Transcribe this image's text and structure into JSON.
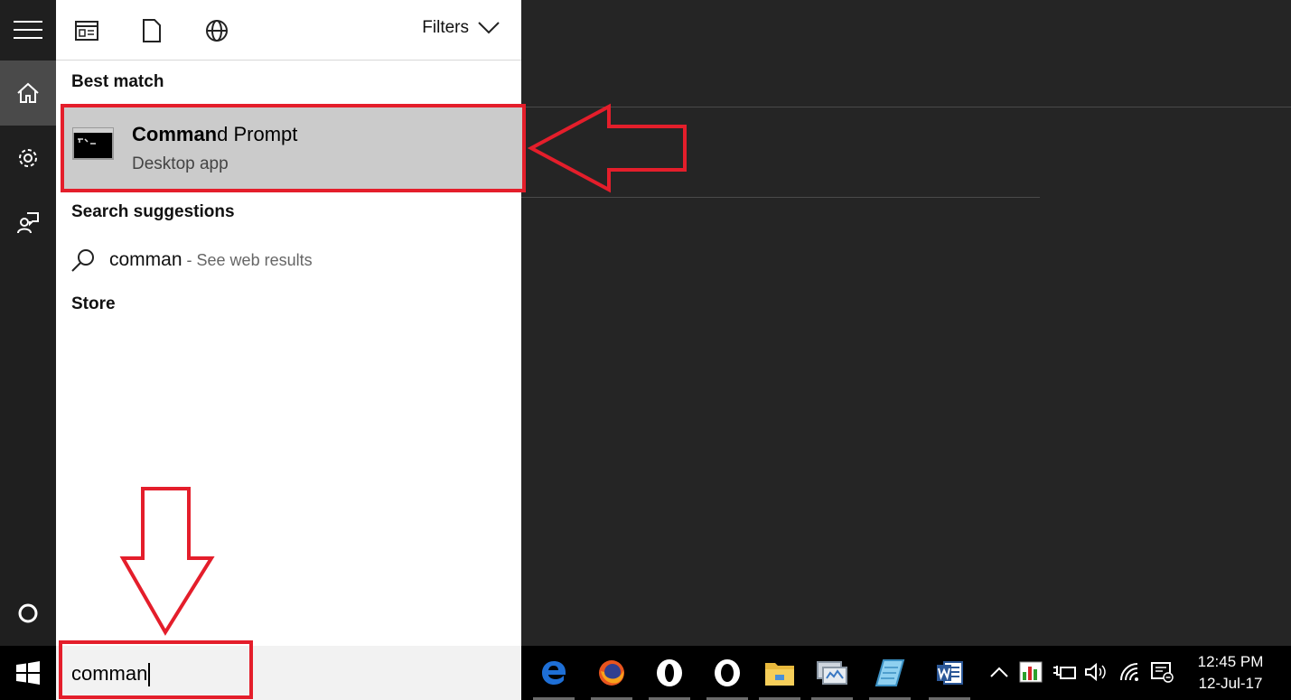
{
  "panel": {
    "filters_label": "Filters",
    "sections": {
      "best_match": "Best match",
      "search_suggestions": "Search suggestions",
      "store": "Store"
    },
    "best_match_item": {
      "name_bold": "Comman",
      "name_rest": "d Prompt",
      "type": "Desktop app"
    },
    "suggestion": {
      "query": "comman",
      "hint": " - See web results"
    }
  },
  "search": {
    "value": "comman"
  },
  "clock": {
    "time": "12:45 PM",
    "date": "12-Jul-17"
  },
  "icons": {
    "rail": [
      "hamburger-icon",
      "home-icon",
      "gear-icon",
      "feedback-icon",
      "cortana-circle-icon"
    ],
    "filters": [
      "apps-filter-icon",
      "documents-filter-icon",
      "web-filter-icon"
    ],
    "taskbar": [
      "edge-icon",
      "firefox-icon",
      "opera-icon",
      "opera-icon",
      "file-explorer-icon",
      "remote-desktop-icon",
      "notepad-icon",
      "word-icon"
    ],
    "tray": [
      "chevron-up-icon",
      "performance-meter-icon",
      "power-plug-icon",
      "volume-icon",
      "wifi-icon",
      "action-center-icon"
    ]
  },
  "colors": {
    "annotation_red": "#e41e2b",
    "highlight_gray": "#cbcbcb",
    "edge_blue": "#1e6fd6",
    "word_blue": "#2b5797"
  }
}
